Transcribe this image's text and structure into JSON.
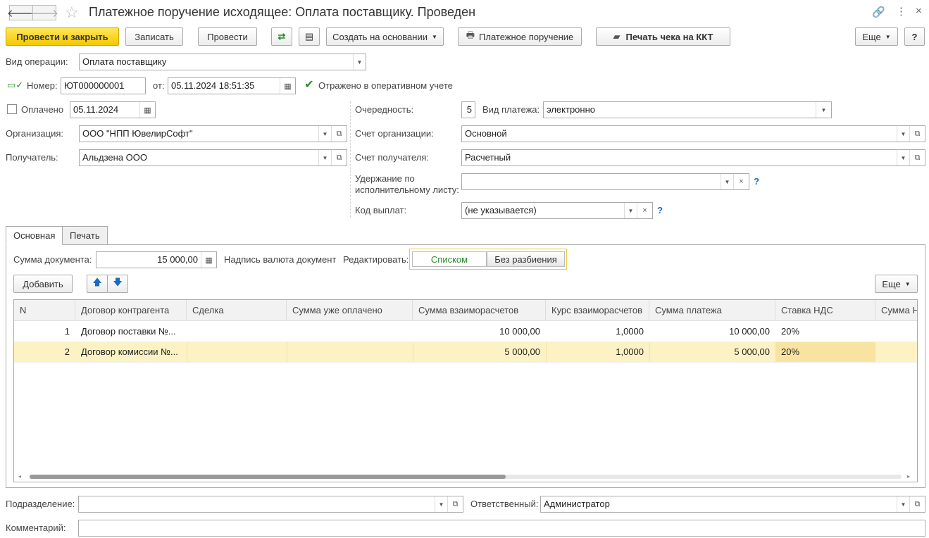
{
  "window": {
    "title": "Платежное поручение исходящее: Оплата поставщику. Проведен"
  },
  "toolbar": {
    "post_close": "Провести и закрыть",
    "save": "Записать",
    "post": "Провести",
    "create_based": "Создать на основании",
    "payment_order": "Платежное поручение",
    "print_receipt": "Печать чека на ККТ",
    "more": "Еще",
    "help": "?"
  },
  "form": {
    "op_type_label": "Вид операции:",
    "op_type_value": "Оплата поставщику",
    "number_label": "Номер:",
    "number_value": "ЮТ000000001",
    "from_label": "от:",
    "date_value": "05.11.2024 18:51:35",
    "reflected_label": "Отражено в оперативном учете",
    "paid_label": "Оплачено",
    "paid_date": "05.11.2024",
    "priority_label": "Очередность:",
    "priority_value": "5",
    "pay_kind_label": "Вид платежа:",
    "pay_kind_value": "электронно",
    "org_label": "Организация:",
    "org_value": "ООО \"НПП ЮвелирСофт\"",
    "org_account_label": "Счет организации:",
    "org_account_value": "Основной",
    "recipient_label": "Получатель:",
    "recipient_value": "Альдзена ООО",
    "recipient_account_label": "Счет получателя:",
    "recipient_account_value": "Расчетный",
    "withhold_label_1": "Удержание по",
    "withhold_label_2": "исполнительному листу:",
    "withhold_value": "",
    "payout_code_label": "Код выплат:",
    "payout_code_value": "(не указывается)",
    "help_q": "?"
  },
  "tabs": [
    "Основная",
    "Печать"
  ],
  "main": {
    "sum_label": "Сумма документа:",
    "sum_value": "15 000,00",
    "currency_caption": "Надпись валюта документ",
    "edit_label": "Редактировать:",
    "edit_list": "Списком",
    "edit_no_split": "Без разбиения",
    "add": "Добавить",
    "more": "Еще"
  },
  "table": {
    "columns": [
      "N",
      "Договор контрагента",
      "Сделка",
      "Сумма уже оплачено",
      "Сумма взаиморасчетов",
      "Курс взаиморасчетов",
      "Сумма платежа",
      "Ставка НДС",
      "Сумма Н"
    ],
    "rows": [
      {
        "n": "1",
        "contract": "Договор поставки №...",
        "deal": "",
        "paid": "",
        "settle": "10 000,00",
        "rate": "1,0000",
        "payment": "10 000,00",
        "vat": "20%"
      },
      {
        "n": "2",
        "contract": "Договор комиссии №...",
        "deal": "",
        "paid": "",
        "settle": "5 000,00",
        "rate": "1,0000",
        "payment": "5 000,00",
        "vat": "20%"
      }
    ]
  },
  "footer": {
    "dept_label": "Подразделение:",
    "dept_value": "",
    "resp_label": "Ответственный:",
    "resp_value": "Администратор",
    "comment_label": "Комментарий:",
    "comment_value": ""
  },
  "colors": {
    "accent": "#f5c800",
    "row_selected": "#fcf2c4",
    "cell_selected": "#f8e3a0",
    "green": "#2a8a2a"
  }
}
